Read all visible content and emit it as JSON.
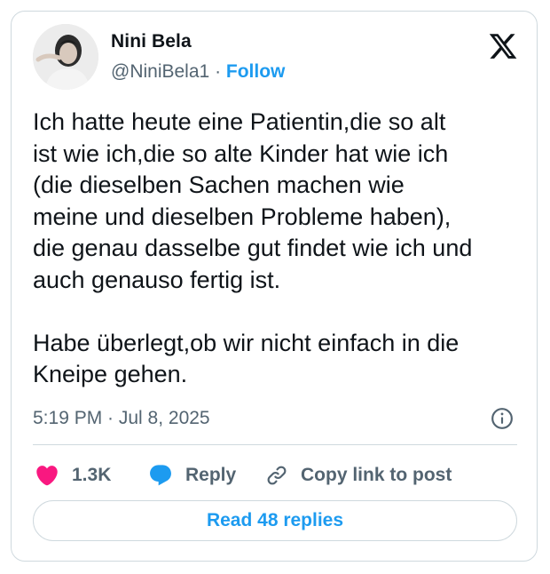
{
  "author": {
    "name": "Nini Bela",
    "handle": "@NiniBela1",
    "separator": "·",
    "follow_label": "Follow"
  },
  "tweet": {
    "text": "Ich hatte heute eine Patientin,die so alt\nist wie ich,die so alte Kinder hat wie ich\n(die dieselben Sachen machen wie\nmeine und dieselben Probleme haben),\ndie genau dasselbe gut findet wie ich und\nauch genauso fertig ist.\n\nHabe überlegt,ob wir nicht einfach in die\nKneipe gehen.",
    "timestamp": "5:19 PM · Jul 8, 2025"
  },
  "actions": {
    "likes_count": "1.3K",
    "reply_label": "Reply",
    "copy_link_label": "Copy link to post"
  },
  "read_replies_label": "Read 48 replies",
  "colors": {
    "accent": "#1d9bf0",
    "like": "#f91880",
    "text": "#0f1419",
    "secondary": "#536471",
    "border": "#cfd9de"
  },
  "icons": [
    "x-logo-icon",
    "info-icon",
    "heart-icon",
    "reply-bubble-icon",
    "link-icon"
  ]
}
